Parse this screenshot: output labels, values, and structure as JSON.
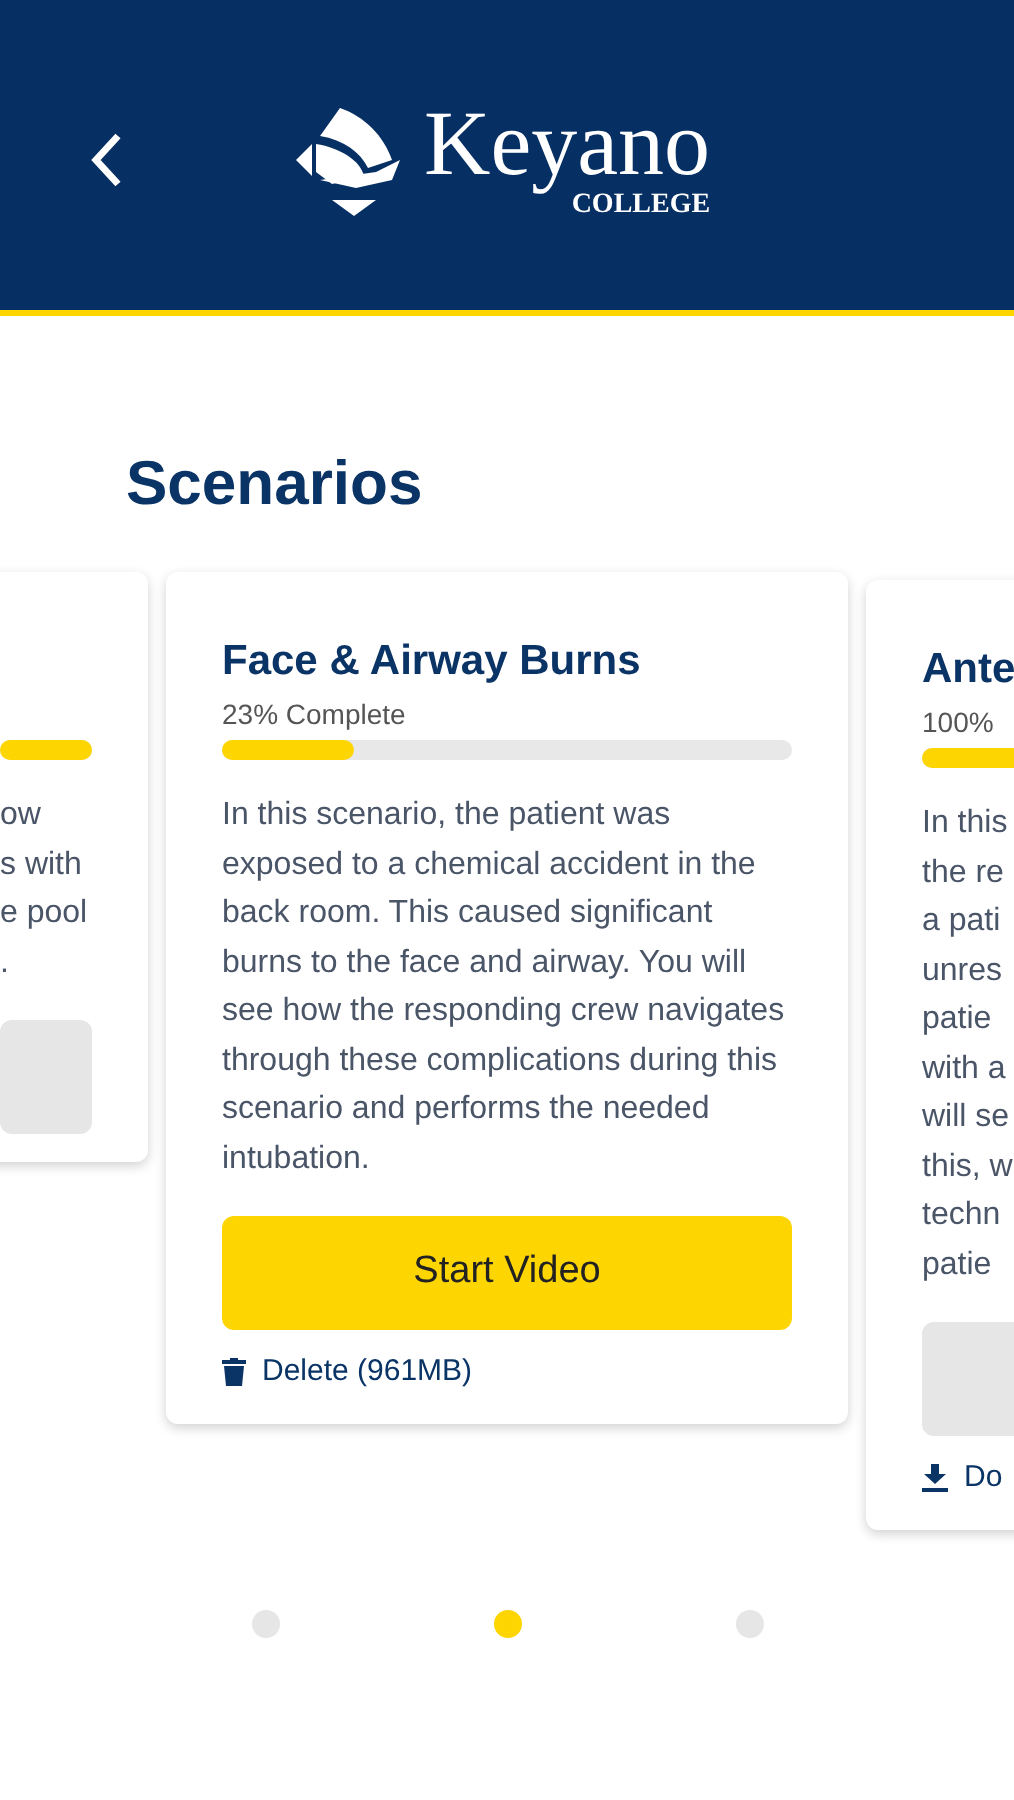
{
  "header": {
    "logo": {
      "name": "Keyano",
      "sub": "COLLEGE"
    }
  },
  "title": "Scenarios",
  "cards": [
    {
      "kind": "left_edge",
      "level": 1,
      "body_lines": [
        "ow",
        "s with",
        "e pool",
        "."
      ],
      "downloaded": false
    },
    {
      "kind": "full",
      "title": "Face & Airway Burns",
      "progress_label": "23% Complete",
      "level": 0.23,
      "body": "In this scenario, the patient was exposed to a chemical accident in the back room. This caused significant burns to the face and airway. You will see how the responding crew navigates through these complications during this scenario and performs the needed intubation.",
      "downloaded": true,
      "button": "Start Video",
      "link": "Delete (961MB)"
    },
    {
      "kind": "right_edge",
      "title": "Ante",
      "progress_label": "100%",
      "level": 1,
      "body_lines": [
        "In this",
        "the re",
        "a pati",
        "unres",
        "patie",
        "with a",
        "will se",
        "this, w",
        "techn",
        "patie"
      ],
      "downloaded": false,
      "link": "Do"
    }
  ],
  "dots": [
    {
      "selected": false
    },
    {
      "selected": true
    },
    {
      "selected": false
    }
  ]
}
